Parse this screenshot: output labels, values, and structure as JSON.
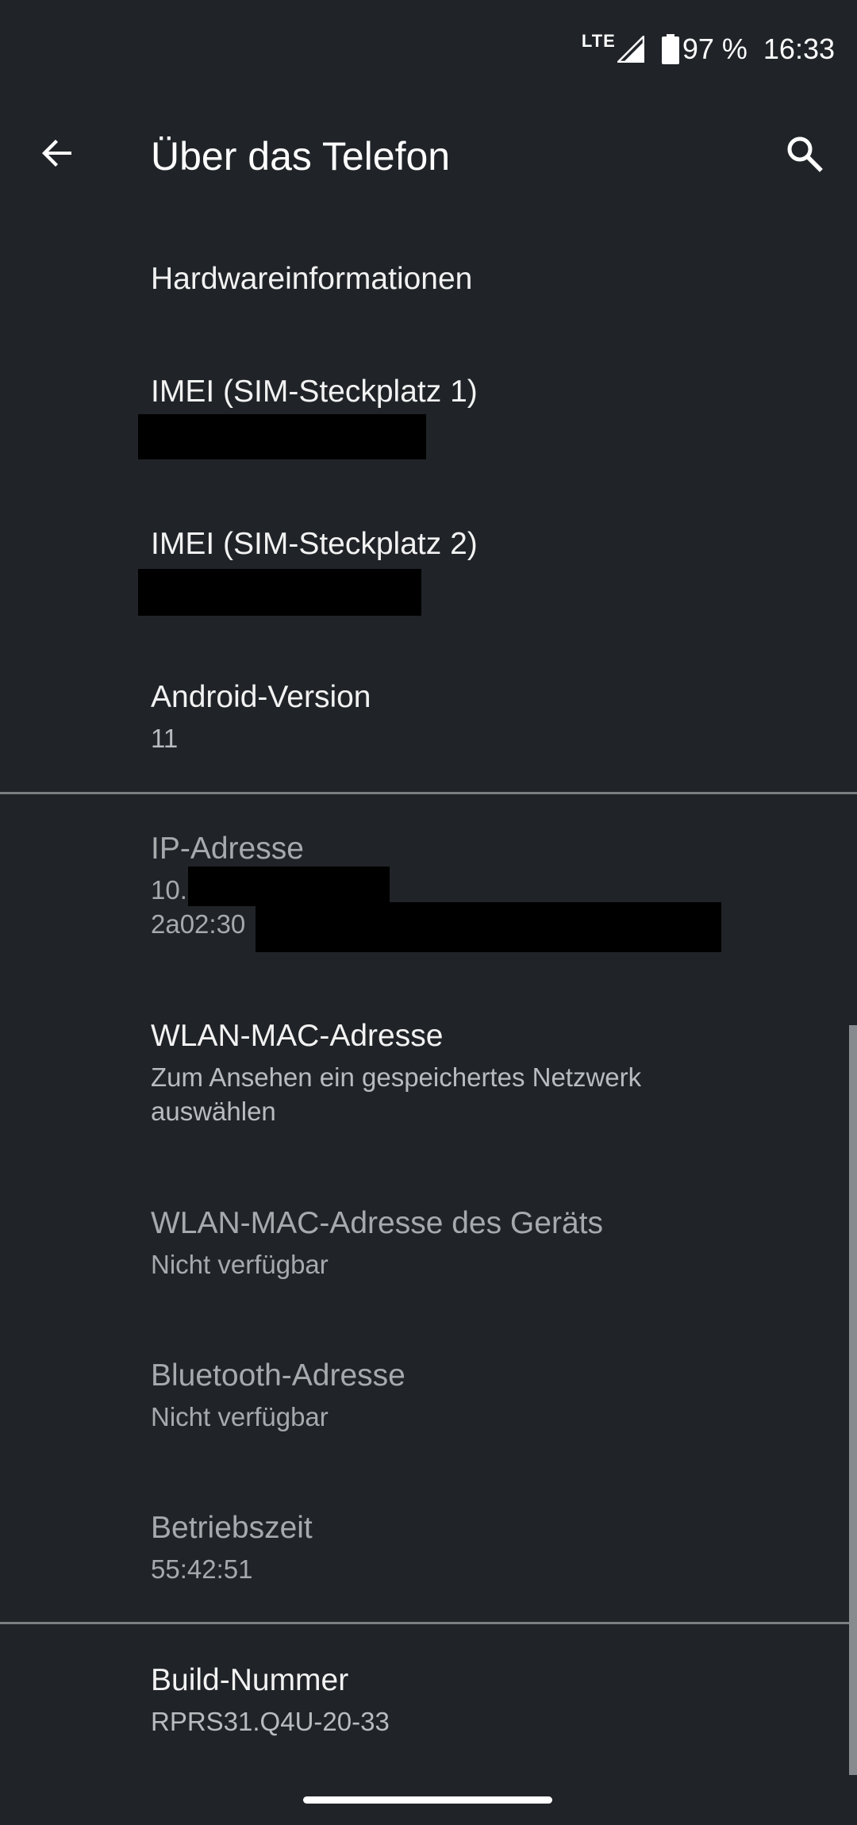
{
  "status_bar": {
    "network": "LTE",
    "battery": "97 %",
    "time": "16:33",
    "icons": [
      "signal-icon",
      "battery-icon"
    ]
  },
  "app_bar": {
    "title": "Über das Telefon",
    "back_icon": "arrow-back-icon",
    "search_icon": "search-icon"
  },
  "items": [
    {
      "title": "Hardwareinformationen"
    },
    {
      "title": "IMEI (SIM-Steckplatz 1)"
    },
    {
      "title": "IMEI (SIM-Steckplatz 2)"
    },
    {
      "title": "Android-Version",
      "value": "11"
    },
    {
      "title": "IP-Adresse",
      "value_line1": "10.",
      "value_line2": "2a02:30"
    },
    {
      "title": "WLAN-MAC-Adresse",
      "value_line1": "Zum Ansehen ein gespeichertes Netzwerk",
      "value_line2": "auswählen"
    },
    {
      "title": "WLAN-MAC-Adresse des Geräts",
      "value": "Nicht verfügbar"
    },
    {
      "title": "Bluetooth-Adresse",
      "value": "Nicht verfügbar"
    },
    {
      "title": "Betriebszeit",
      "value": "55:42:51"
    },
    {
      "title": "Build-Nummer",
      "value": "RPRS31.Q4U-20-33"
    }
  ]
}
